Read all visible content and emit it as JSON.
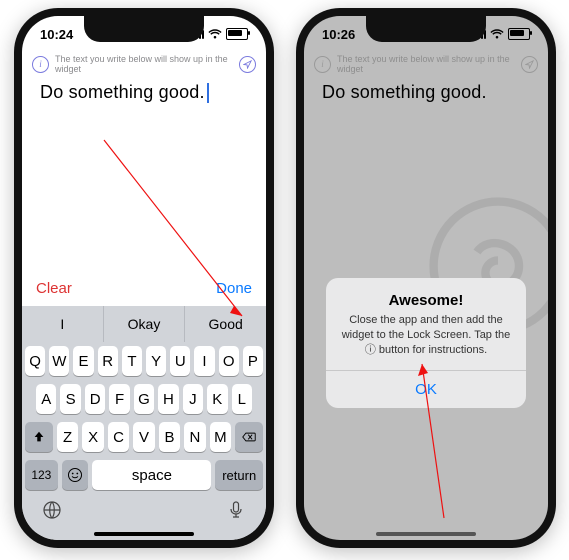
{
  "left": {
    "time": "10:24",
    "hint": "The text you write below will show up in the widget",
    "content": "Do something good.",
    "clear": "Clear",
    "done": "Done",
    "suggestions": [
      "I",
      "Okay",
      "Good"
    ],
    "rows": {
      "r1": [
        "Q",
        "W",
        "E",
        "R",
        "T",
        "Y",
        "U",
        "I",
        "O",
        "P"
      ],
      "r2": [
        "A",
        "S",
        "D",
        "F",
        "G",
        "H",
        "J",
        "K",
        "L"
      ],
      "r3": [
        "Z",
        "X",
        "C",
        "V",
        "B",
        "N",
        "M"
      ]
    },
    "n123": "123",
    "space": "space",
    "ret": "return"
  },
  "right": {
    "time": "10:26",
    "hint": "The text you write below will show up in the widget",
    "content": "Do something good.",
    "alert": {
      "title": "Awesome!",
      "message": "Close the app and then add the widget to the Lock Screen. Tap the ⓘ button for instructions.",
      "ok": "OK"
    }
  }
}
